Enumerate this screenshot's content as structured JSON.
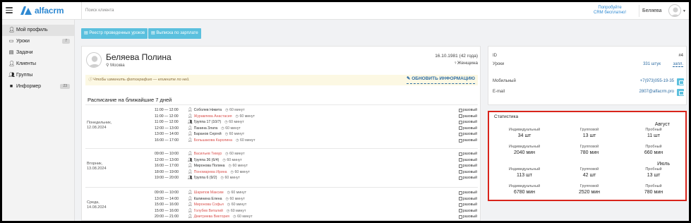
{
  "app": {
    "logo_text": "alfacrm"
  },
  "topbar": {
    "search_placeholder": "Поиск клиента",
    "promo_line1": "Попробуйте",
    "promo_line2": "CRM бесплатно!",
    "user_name": "Беляева"
  },
  "sidebar": {
    "items": [
      {
        "label": "Мой профиль",
        "icon": "user-icon",
        "badge": ""
      },
      {
        "label": "Уроки",
        "icon": "calendar-icon",
        "badge": "7"
      },
      {
        "label": "Задачи",
        "icon": "tasks-icon",
        "badge": ""
      },
      {
        "label": "Клиенты",
        "icon": "user-icon",
        "badge": ""
      },
      {
        "label": "Группы",
        "icon": "group-icon",
        "badge": ""
      },
      {
        "label": "Информер",
        "icon": "informer-icon",
        "badge": "23"
      }
    ]
  },
  "toolbar": {
    "lessons_registry": "Реестр проведенных уроков",
    "salary_statement": "Выписка по зарплате"
  },
  "profile": {
    "name": "Беляева Полина",
    "city": "Москва",
    "dob": "16.10.1981 (42 года)",
    "gender": "Женщина",
    "photo_notice": "Чтобы изменить фотографию — кликните по ней.",
    "update_label": "ОБНОВИТЬ ИНФОРМАЦИЮ"
  },
  "schedule": {
    "title": "Расписание на ближайшие 7 дней",
    "once_label": "разовый",
    "days": [
      {
        "day": "Понедельник,",
        "date": "12.08.2024",
        "lessons": [
          {
            "time": "11:00 — 12:00",
            "who": "Соболев Никита",
            "red": false,
            "dur": "60 минут"
          },
          {
            "time": "11:00 — 12:00",
            "who": "Журавлева Анастасия",
            "red": true,
            "dur": "60 минут"
          },
          {
            "time": "11:00 — 12:00",
            "who": "Группа 17 (10/7)",
            "red": false,
            "dur": "60 минут"
          },
          {
            "time": "12:00 — 13:00",
            "who": "Панина Злата",
            "red": false,
            "dur": "60 минут"
          },
          {
            "time": "13:00 — 14:00",
            "who": "Баранов Сергей",
            "red": false,
            "dur": "60 минут"
          },
          {
            "time": "16:00 — 17:00",
            "who": "Большакова Каролина",
            "red": true,
            "dur": "60 минут"
          }
        ]
      },
      {
        "day": "Вторник,",
        "date": "13.08.2024",
        "lessons": [
          {
            "time": "09:00 — 10:00",
            "who": "Васильев Тимур",
            "red": true,
            "dur": "60 минут"
          },
          {
            "time": "12:00 — 13:00",
            "who": "Группа 36 (6/4)",
            "red": false,
            "dur": "60 минут"
          },
          {
            "time": "16:00 — 17:00",
            "who": "Миронова Полина",
            "red": false,
            "dur": "60 минут"
          },
          {
            "time": "18:00 — 19:00",
            "who": "Пономарева Ирина",
            "red": true,
            "dur": "60 минут"
          },
          {
            "time": "19:00 — 20:00",
            "who": "Группа 6 (9/2)",
            "red": false,
            "dur": "60 минут"
          }
        ]
      },
      {
        "day": "Среда,",
        "date": "14.08.2024",
        "lessons": [
          {
            "time": "09:00 — 10:00",
            "who": "Шарипов Максим",
            "red": true,
            "dur": "60 минут"
          },
          {
            "time": "13:00 — 14:00",
            "who": "Калинина Елена",
            "red": false,
            "dur": "60 минут"
          },
          {
            "time": "15:00 — 16:00",
            "who": "Миронова Софья",
            "red": true,
            "dur": "60 минут"
          },
          {
            "time": "15:00 — 16:00",
            "who": "Голубев Виталий",
            "red": true,
            "dur": "60 минут"
          },
          {
            "time": "20:00 — 21:00",
            "who": "Дмитриева Виктория",
            "red": true,
            "dur": "60 минут"
          }
        ]
      }
    ]
  },
  "info": {
    "id_label": "ID",
    "id_value": "#4",
    "lessons_label": "Уроки",
    "lessons_value": "331 штук",
    "lessons_link": "запл.",
    "mobile_label": "Мобильный",
    "mobile_value": "+7(973)055-19-35",
    "email_label": "E-mail",
    "email_value": "2807@alfacrm.pro"
  },
  "stats": {
    "title": "Статистика",
    "months": [
      {
        "name": "Август",
        "rows": [
          [
            {
              "label": "Индивидуальный",
              "value": "34 шт"
            },
            {
              "label": "Групповой",
              "value": "13 шт"
            },
            {
              "label": "Пробный",
              "value": "11 шт"
            }
          ],
          [
            {
              "label": "Индивидуальный",
              "value": "2040 мин"
            },
            {
              "label": "Групповой",
              "value": "780 мин"
            },
            {
              "label": "Пробный",
              "value": "660 мин"
            }
          ]
        ]
      },
      {
        "name": "Июль",
        "rows": [
          [
            {
              "label": "Индивидуальный",
              "value": "113 шт"
            },
            {
              "label": "Групповой",
              "value": "42 шт"
            },
            {
              "label": "Пробный",
              "value": "13 шт"
            }
          ],
          [
            {
              "label": "Индивидуальный",
              "value": "6780 мин"
            },
            {
              "label": "Групповой",
              "value": "2520 мин"
            },
            {
              "label": "Пробный",
              "value": "780 мин"
            }
          ]
        ]
      }
    ]
  },
  "colors": {
    "accent": "#2e89d2",
    "button": "#5bc0de",
    "highlight": "#d9241b",
    "student_red": "#d9534f"
  }
}
